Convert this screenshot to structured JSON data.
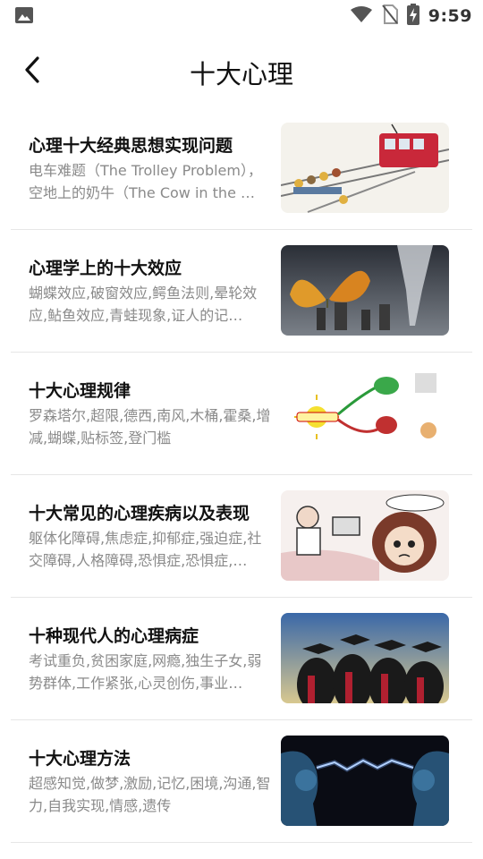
{
  "status": {
    "time": "9:59",
    "icons": [
      "image-icon",
      "wifi-icon",
      "no-sim-icon",
      "battery-charging-icon"
    ]
  },
  "header": {
    "title": "十大心理",
    "back_icon": "back-arrow-icon"
  },
  "items": [
    {
      "title": "心理十大经典思想实现问题",
      "desc": "电车难题（The Trolley Problem），空地上的奶牛（The Cow in the …",
      "thumb": "trolley-cartoon-image"
    },
    {
      "title": "心理学上的十大效应",
      "desc": "蝴蝶效应,破窗效应,鳄鱼法则,晕轮效应,鲇鱼效应,青蛙现象,证人的记…",
      "thumb": "butterfly-tornado-image"
    },
    {
      "title": "十大心理规律",
      "desc": "罗森塔尔,超限,德西,南风,木桶,霍桑,增减,蝴蝶,贴标签,登门槛",
      "thumb": "rosenthal-mindmap-image"
    },
    {
      "title": "十大常见的心理疾病以及表现",
      "desc": "躯体化障碍,焦虑症,抑郁症,强迫症,社交障碍,人格障碍,恐惧症,恐惧症,…",
      "thumb": "anxious-girl-cartoon-image"
    },
    {
      "title": "十种现代人的心理病症",
      "desc": "考试重负,贫困家庭,网瘾,独生子女,弱势群体,工作紧张,心灵创伤,事业…",
      "thumb": "graduates-image"
    },
    {
      "title": "十大心理方法",
      "desc": "超感知觉,做梦,激励,记忆,困境,沟通,智力,自我实现,情感,遗传",
      "thumb": "two-heads-lightning-image"
    }
  ]
}
